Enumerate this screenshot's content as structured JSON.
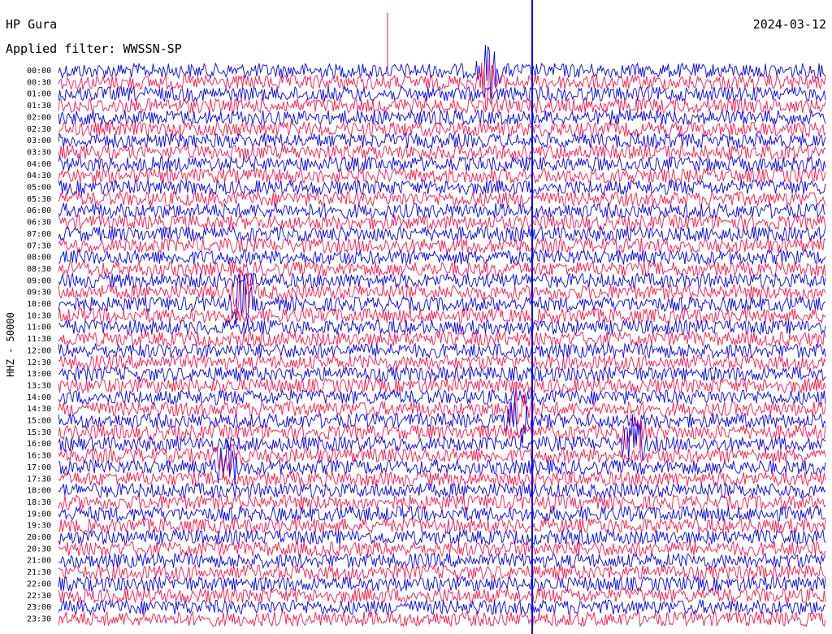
{
  "header": {
    "station": "HP Gura",
    "date": "2024-03-12",
    "filter": "Applied filter: WWSSN-SP"
  },
  "colors": {
    "trace_a": "#0000ff",
    "trace_b": "#ff1744",
    "background": "#ffffff"
  },
  "chart_data": {
    "type": "line",
    "title": "HP Gura",
    "ylabel": "HHZ - 50000",
    "row_labels": [
      "00:00",
      "00:30",
      "01:00",
      "01:30",
      "02:00",
      "02:30",
      "03:00",
      "03:30",
      "04:00",
      "04:30",
      "05:00",
      "05:30",
      "06:00",
      "06:30",
      "07:00",
      "07:30",
      "08:00",
      "08:30",
      "09:00",
      "09:30",
      "10:00",
      "10:30",
      "11:00",
      "11:30",
      "12:00",
      "12:30",
      "13:00",
      "13:30",
      "14:00",
      "14:30",
      "15:00",
      "15:30",
      "16:00",
      "16:30",
      "17:00",
      "17:30",
      "18:00",
      "18:30",
      "19:00",
      "19:30",
      "20:00",
      "20:30",
      "21:00",
      "21:30",
      "22:00",
      "22:30",
      "23:00",
      "23:30"
    ],
    "rows_minutes": 30,
    "trace_colors_alternate": [
      "blue",
      "red"
    ],
    "grid": false,
    "events": [
      {
        "row": "00:00",
        "x_fraction": 0.56,
        "description": "tall blue spike"
      },
      {
        "row": "09:30",
        "x_fraction": 0.24,
        "description": "blue burst"
      },
      {
        "row": "14:30",
        "x_fraction": 0.6,
        "description": "large blue event"
      },
      {
        "row": "15:30",
        "x_fraction": 0.75,
        "description": "blue burst"
      },
      {
        "row": "16:30",
        "x_fraction": 0.22,
        "description": "blue burst"
      }
    ]
  }
}
